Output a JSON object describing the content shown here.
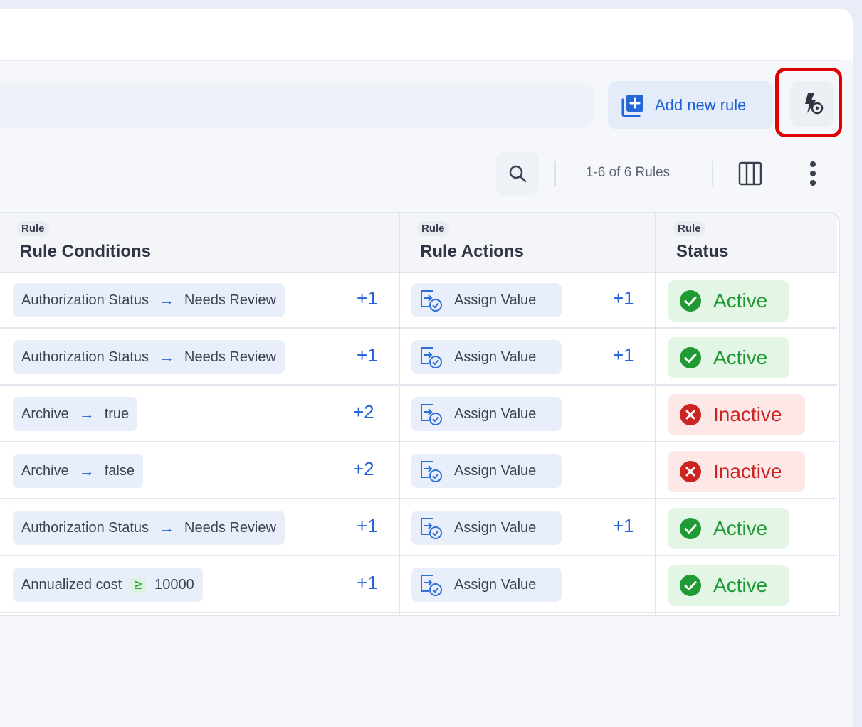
{
  "toolbar": {
    "add_rule_label": "Add new rule",
    "run_rules_icon": "lightning-play-icon",
    "rule_count": "1-6 of 6 Rules"
  },
  "table": {
    "columns": [
      {
        "small": "Rule",
        "title": "Rule Conditions"
      },
      {
        "small": "Rule",
        "title": "Rule Actions"
      },
      {
        "small": "Rule",
        "title": "Status"
      }
    ],
    "rows": [
      {
        "cond_field": "Authorization Status",
        "cond_op": "→",
        "cond_value": "Needs Review",
        "cond_more": "+1",
        "action": "Assign Value",
        "action_more": "+1",
        "status": "Active"
      },
      {
        "cond_field": "Authorization Status",
        "cond_op": "→",
        "cond_value": "Needs Review",
        "cond_more": "+1",
        "action": "Assign Value",
        "action_more": "+1",
        "status": "Active"
      },
      {
        "cond_field": "Archive",
        "cond_op": "→",
        "cond_value": "true",
        "cond_more": "+2",
        "action": "Assign Value",
        "action_more": "",
        "status": "Inactive"
      },
      {
        "cond_field": "Archive",
        "cond_op": "→",
        "cond_value": "false",
        "cond_more": "+2",
        "action": "Assign Value",
        "action_more": "",
        "status": "Inactive"
      },
      {
        "cond_field": "Authorization Status",
        "cond_op": "→",
        "cond_value": "Needs Review",
        "cond_more": "+1",
        "action": "Assign Value",
        "action_more": "+1",
        "status": "Active"
      },
      {
        "cond_field": "Annualized cost",
        "cond_op": "≥",
        "cond_value": "10000",
        "cond_more": "+1",
        "action": "Assign Value",
        "action_more": "",
        "status": "Active"
      }
    ]
  },
  "colors": {
    "accent": "#1f5fd6",
    "active": "#1f9a34",
    "inactive": "#cc2323",
    "highlight": "#e00000"
  }
}
